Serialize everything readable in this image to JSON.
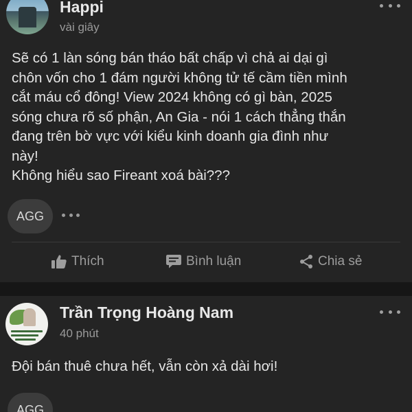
{
  "posts": [
    {
      "author": "Happi",
      "time": "vài giây",
      "body_lines": [
        "Sẽ có 1 làn sóng bán tháo bất chấp vì chả ai dại gì",
        "chôn vốn cho 1 đám người không tử tế cầm tiền mình",
        "cắt máu cổ đông! View 2024 không có gì bàn, 2025",
        "sóng chưa rõ số phận, An Gia - nói 1 cách thẳng thắn",
        "đang trên bờ vực với kiểu kinh doanh gia đình như",
        "này!",
        "Không hiểu sao Fireant xoá bài???"
      ],
      "tag": "AGG"
    },
    {
      "author": "Trần Trọng Hoàng Nam",
      "time": "40 phút",
      "body_lines": [
        "Đội bán thuê chưa hết, vẫn còn xả dài hơi!"
      ],
      "tag": "AGG"
    }
  ],
  "actions": {
    "like": "Thích",
    "comment": "Bình luận",
    "share": "Chia sẻ"
  },
  "icons": {
    "more": "more-horizontal-icon",
    "like": "thumbs-up-icon",
    "comment": "comment-icon",
    "share": "share-icon"
  },
  "colors": {
    "background": "#242424",
    "separator": "#161616",
    "text": "#e6e6e6",
    "muted": "#9d9d9d",
    "chip": "#3c3c3c"
  }
}
